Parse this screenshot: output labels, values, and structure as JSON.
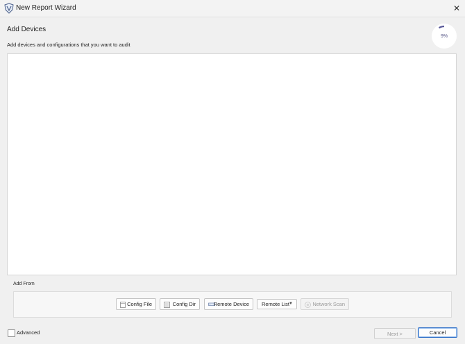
{
  "window": {
    "title": "New Report Wizard",
    "close_icon": "close-icon",
    "app_icon": "shield-logo-icon"
  },
  "header": {
    "title": "Add Devices",
    "subtitle": "Add devices and configurations that you want to audit"
  },
  "progress": {
    "label": "9%",
    "value": 0.09,
    "color": "#5a5a9a"
  },
  "add_from": {
    "label": "Add From",
    "buttons": [
      {
        "label": "Config File",
        "icon": "file-icon",
        "enabled": true
      },
      {
        "label": "Config Dir",
        "icon": "folder-list-icon",
        "enabled": true
      },
      {
        "label": "Remote Device",
        "icon": "network-device-icon",
        "enabled": true
      },
      {
        "label": "Remote List",
        "icon": "dropdown-caret-icon",
        "enabled": true
      },
      {
        "label": "Network Scan",
        "icon": "scan-icon",
        "enabled": false
      }
    ]
  },
  "footer": {
    "advanced_label": "Advanced",
    "advanced_checked": false,
    "next_label": "Next >",
    "next_enabled": false,
    "cancel_label": "Cancel"
  },
  "colors": {
    "accent": "#2f6fc7",
    "dialog_bg": "#f0f0f0"
  }
}
